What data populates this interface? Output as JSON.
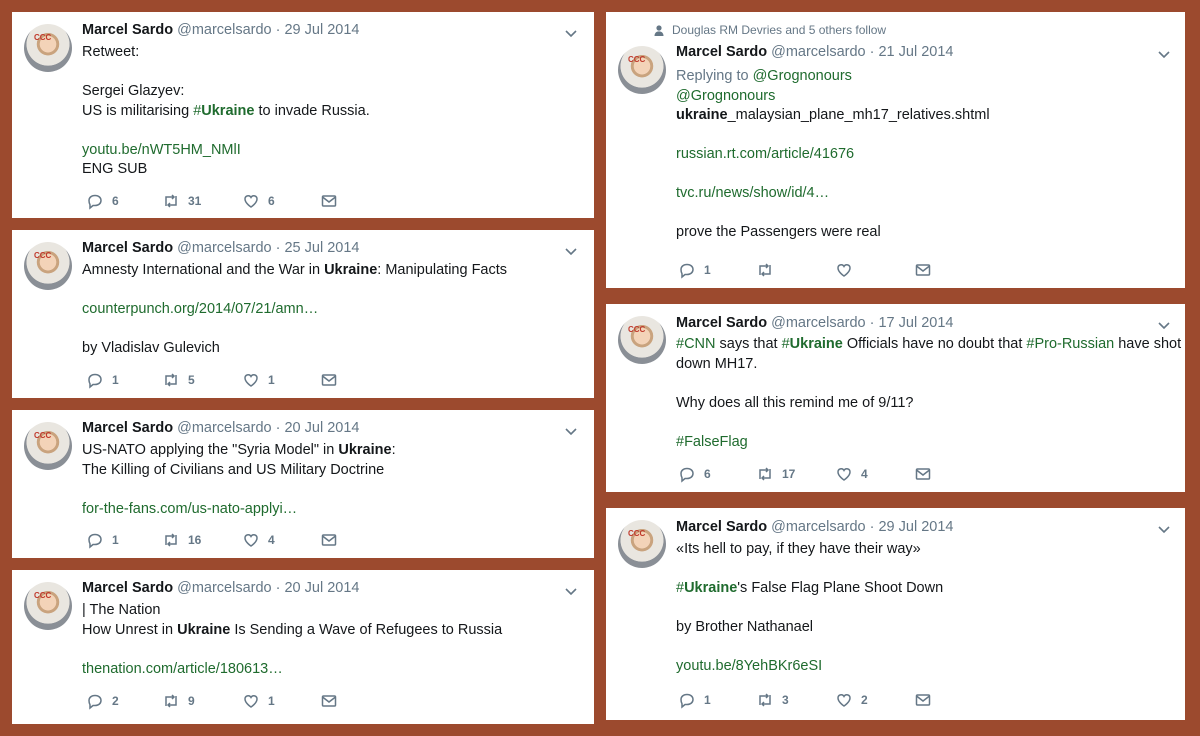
{
  "tweets": {
    "t1": {
      "name": "Marcel Sardo",
      "handle": "@marcelsardo",
      "date": "· 29 Jul 2014",
      "l1": "Retweet:",
      "l2": "Sergei Glazyev:",
      "l3a": "US is militarising ",
      "l3b": "#",
      "l3c": "Ukraine",
      "l3d": " to invade Russia.",
      "l4": "youtu.be/nWT5HM_NMlI",
      "l5": "ENG SUB",
      "reply": "6",
      "retweet": "31",
      "like": "6"
    },
    "t2": {
      "name": "Marcel Sardo",
      "handle": "@marcelsardo",
      "date": "· 25 Jul 2014",
      "l1a": "Amnesty International and the War in ",
      "l1b": "Ukraine",
      "l1c": ": Manipulating Facts",
      "l2": "counterpunch.org/2014/07/21/amn…",
      "l3": "by Vladislav Gulevich",
      "reply": "1",
      "retweet": "5",
      "like": "1"
    },
    "t3": {
      "name": "Marcel Sardo",
      "handle": "@marcelsardo",
      "date": "· 20 Jul 2014",
      "l1a": "US-NATO applying the \"Syria Model\" in ",
      "l1b": "Ukraine",
      "l1c": ":",
      "l2": "The Killing of Civilians and US Military Doctrine",
      "l3": "for-the-fans.com/us-nato-applyi…",
      "reply": "1",
      "retweet": "16",
      "like": "4"
    },
    "t4": {
      "name": "Marcel Sardo",
      "handle": "@marcelsardo",
      "date": "· 20 Jul 2014",
      "l1": "| The Nation",
      "l2a": "How Unrest in ",
      "l2b": "Ukraine",
      "l2c": " Is Sending a Wave of Refugees to Russia",
      "l3": "thenation.com/article/180613…",
      "reply": "2",
      "retweet": "9",
      "like": "1"
    },
    "t5": {
      "social": "Douglas RM Devries and 5 others follow",
      "name": "Marcel Sardo",
      "handle": "@marcelsardo",
      "date": "· 21 Jul 2014",
      "replying": "Replying to ",
      "replyto": "@Grognonours",
      "l1": "@Grognonours",
      "l2a": "ukraine",
      "l2b": "_malaysian_plane_mh17_relatives.shtml",
      "l3": "russian.rt.com/article/41676",
      "l4": "tvc.ru/news/show/id/4…",
      "l5": "prove the Passengers were real",
      "reply": "1",
      "retweet": "",
      "like": ""
    },
    "t6": {
      "name": "Marcel Sardo",
      "handle": "@marcelsardo",
      "date": "· 17 Jul 2014",
      "l1a": "#CNN",
      "l1b": " says that ",
      "l1c": "#",
      "l1d": "Ukraine",
      "l1e": " Officials  have no doubt that ",
      "l1f": "#Pro-Russian",
      "l1g": " have shot",
      "l2": "down MH17.",
      "l3": "Why does all this remind me of 9/11?",
      "l4": "#FalseFlag",
      "reply": "6",
      "retweet": "17",
      "like": "4"
    },
    "t7": {
      "name": "Marcel Sardo",
      "handle": "@marcelsardo",
      "date": "· 29 Jul 2014",
      "l1": "«Its hell to pay, if they have their way»",
      "l2a": "#",
      "l2b": "Ukraine",
      "l2c": "'s False Flag Plane Shoot Down",
      "l3": "by Brother Nathanael",
      "l4": "youtu.be/8YehBKr6eSI",
      "reply": "1",
      "retweet": "3",
      "like": "2"
    }
  },
  "icons": {
    "avatar": "avatar-photo",
    "reply": "reply-icon",
    "retweet": "retweet-icon",
    "like": "heart-icon",
    "dm": "envelope-icon",
    "caret": "chevron-down-icon",
    "social": "person-icon"
  },
  "colors": {
    "background": "#9c4a2e",
    "link": "#1f6b2e",
    "muted": "#657786"
  }
}
